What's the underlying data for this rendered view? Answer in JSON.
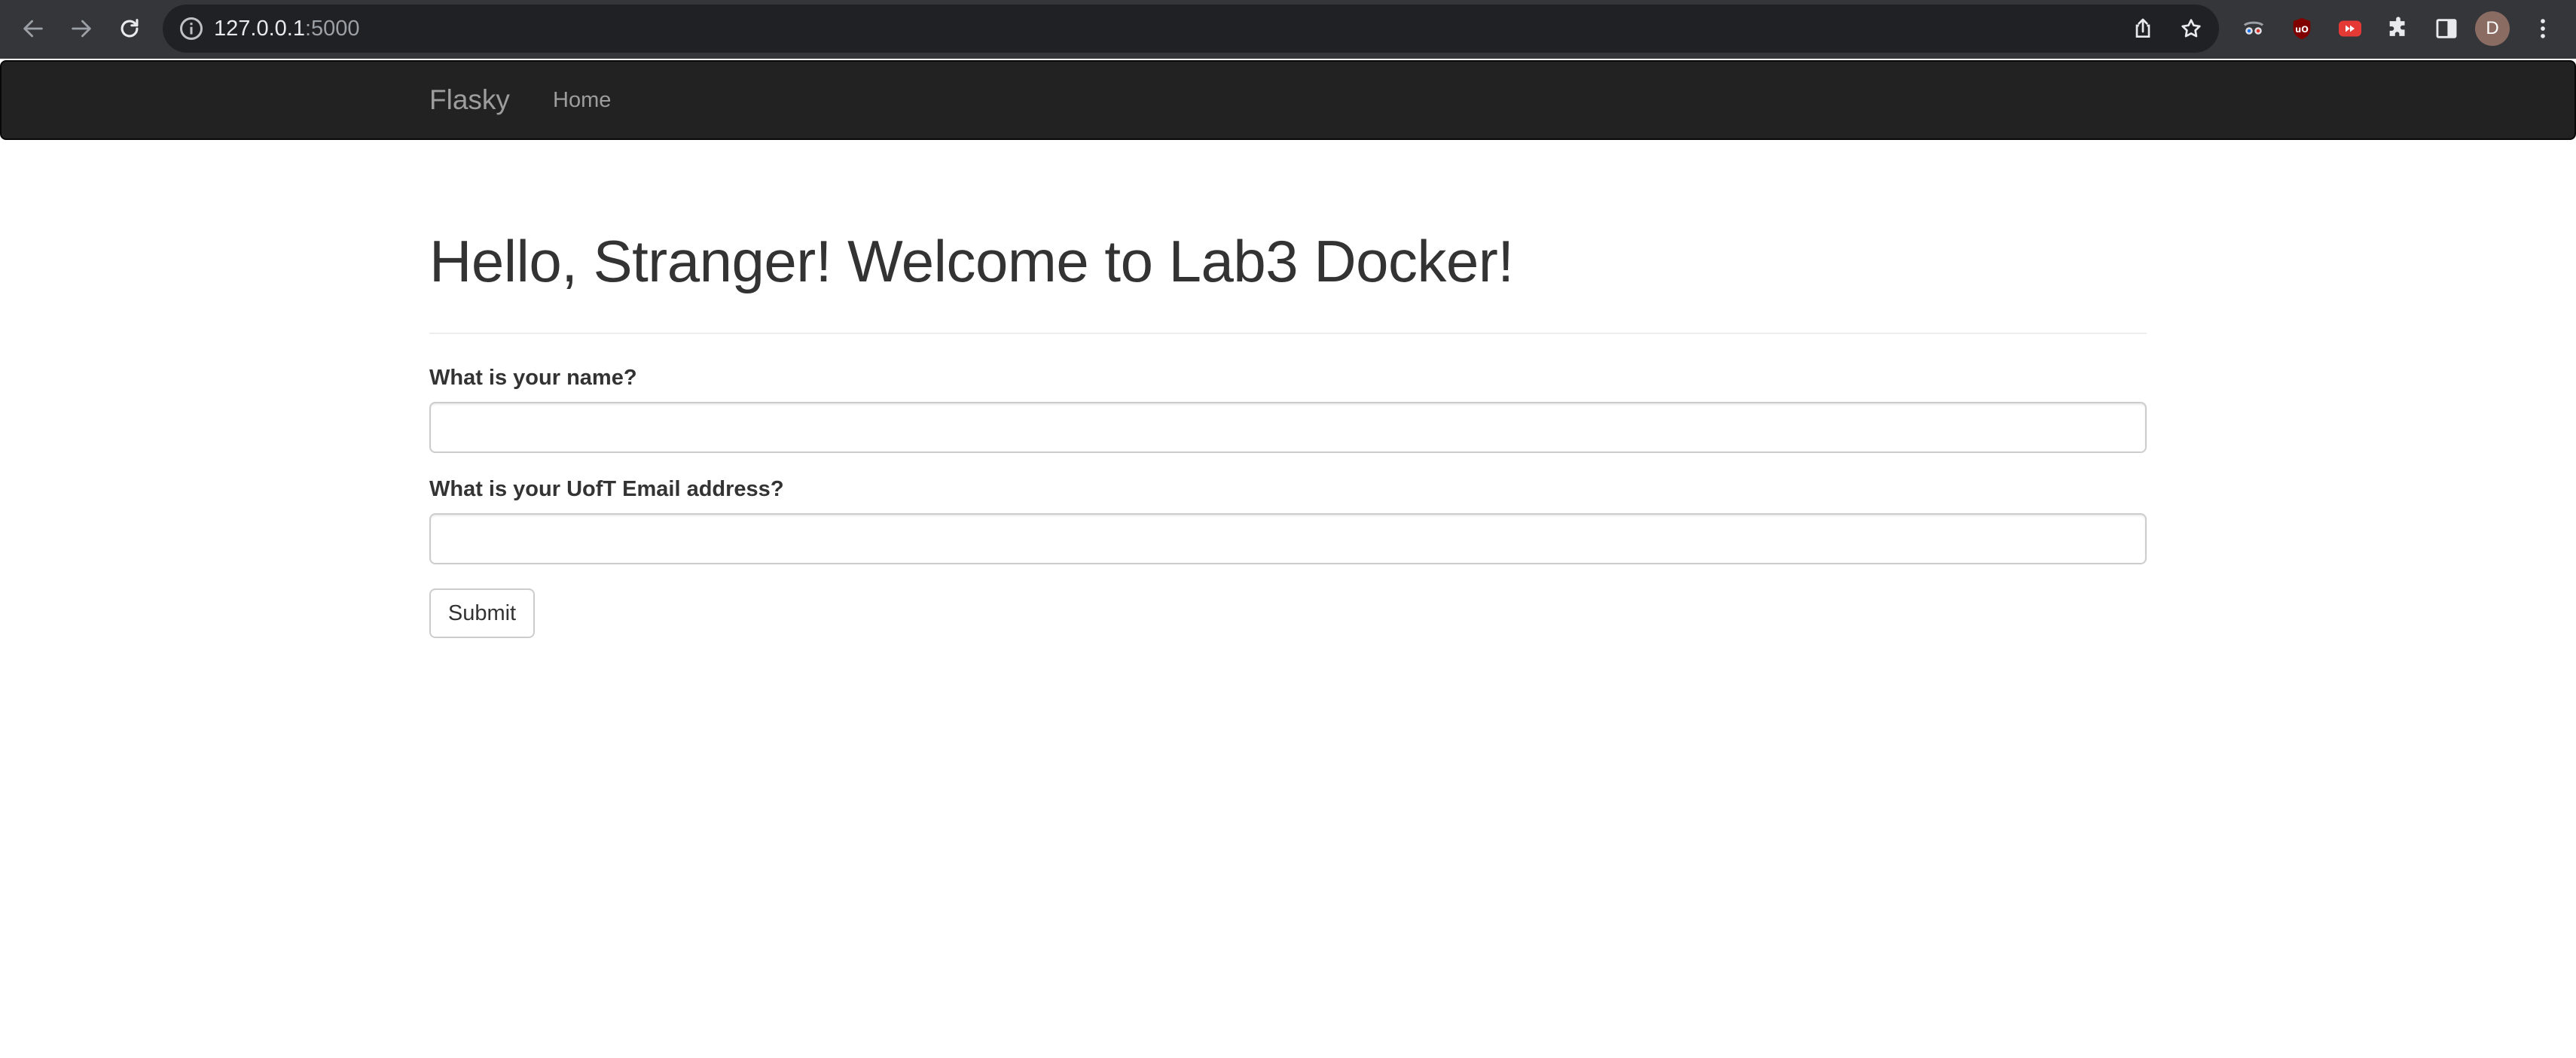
{
  "browser": {
    "url_host": "127.0.0.1",
    "url_port": ":5000",
    "profile_initial": "D",
    "icons": {
      "back": "arrow-left-icon",
      "forward": "arrow-right-icon",
      "reload": "reload-icon",
      "site_info": "info-circle-icon",
      "share": "share-icon",
      "bookmark": "star-icon",
      "extensions": [
        "spy-glasses-extension-icon",
        "ublock-origin-icon",
        "red-play-extension-icon",
        "puzzle-icon",
        "side-panel-icon"
      ],
      "menu": "kebab-menu-icon"
    }
  },
  "navbar": {
    "brand": "Flasky",
    "links": [
      {
        "label": "Home"
      }
    ]
  },
  "main": {
    "heading": "Hello, Stranger! Welcome to Lab3 Docker!",
    "form": {
      "name_label": "What is your name?",
      "name_value": "",
      "email_label": "What is your UofT Email address?",
      "email_value": "",
      "submit_label": "Submit"
    }
  },
  "colors": {
    "chrome_bg": "#35363a",
    "omnibox_bg": "#202124",
    "navbar_bg": "#222222",
    "navbar_text": "#9d9d9d",
    "text": "#333333",
    "input_border": "#cccccc"
  }
}
